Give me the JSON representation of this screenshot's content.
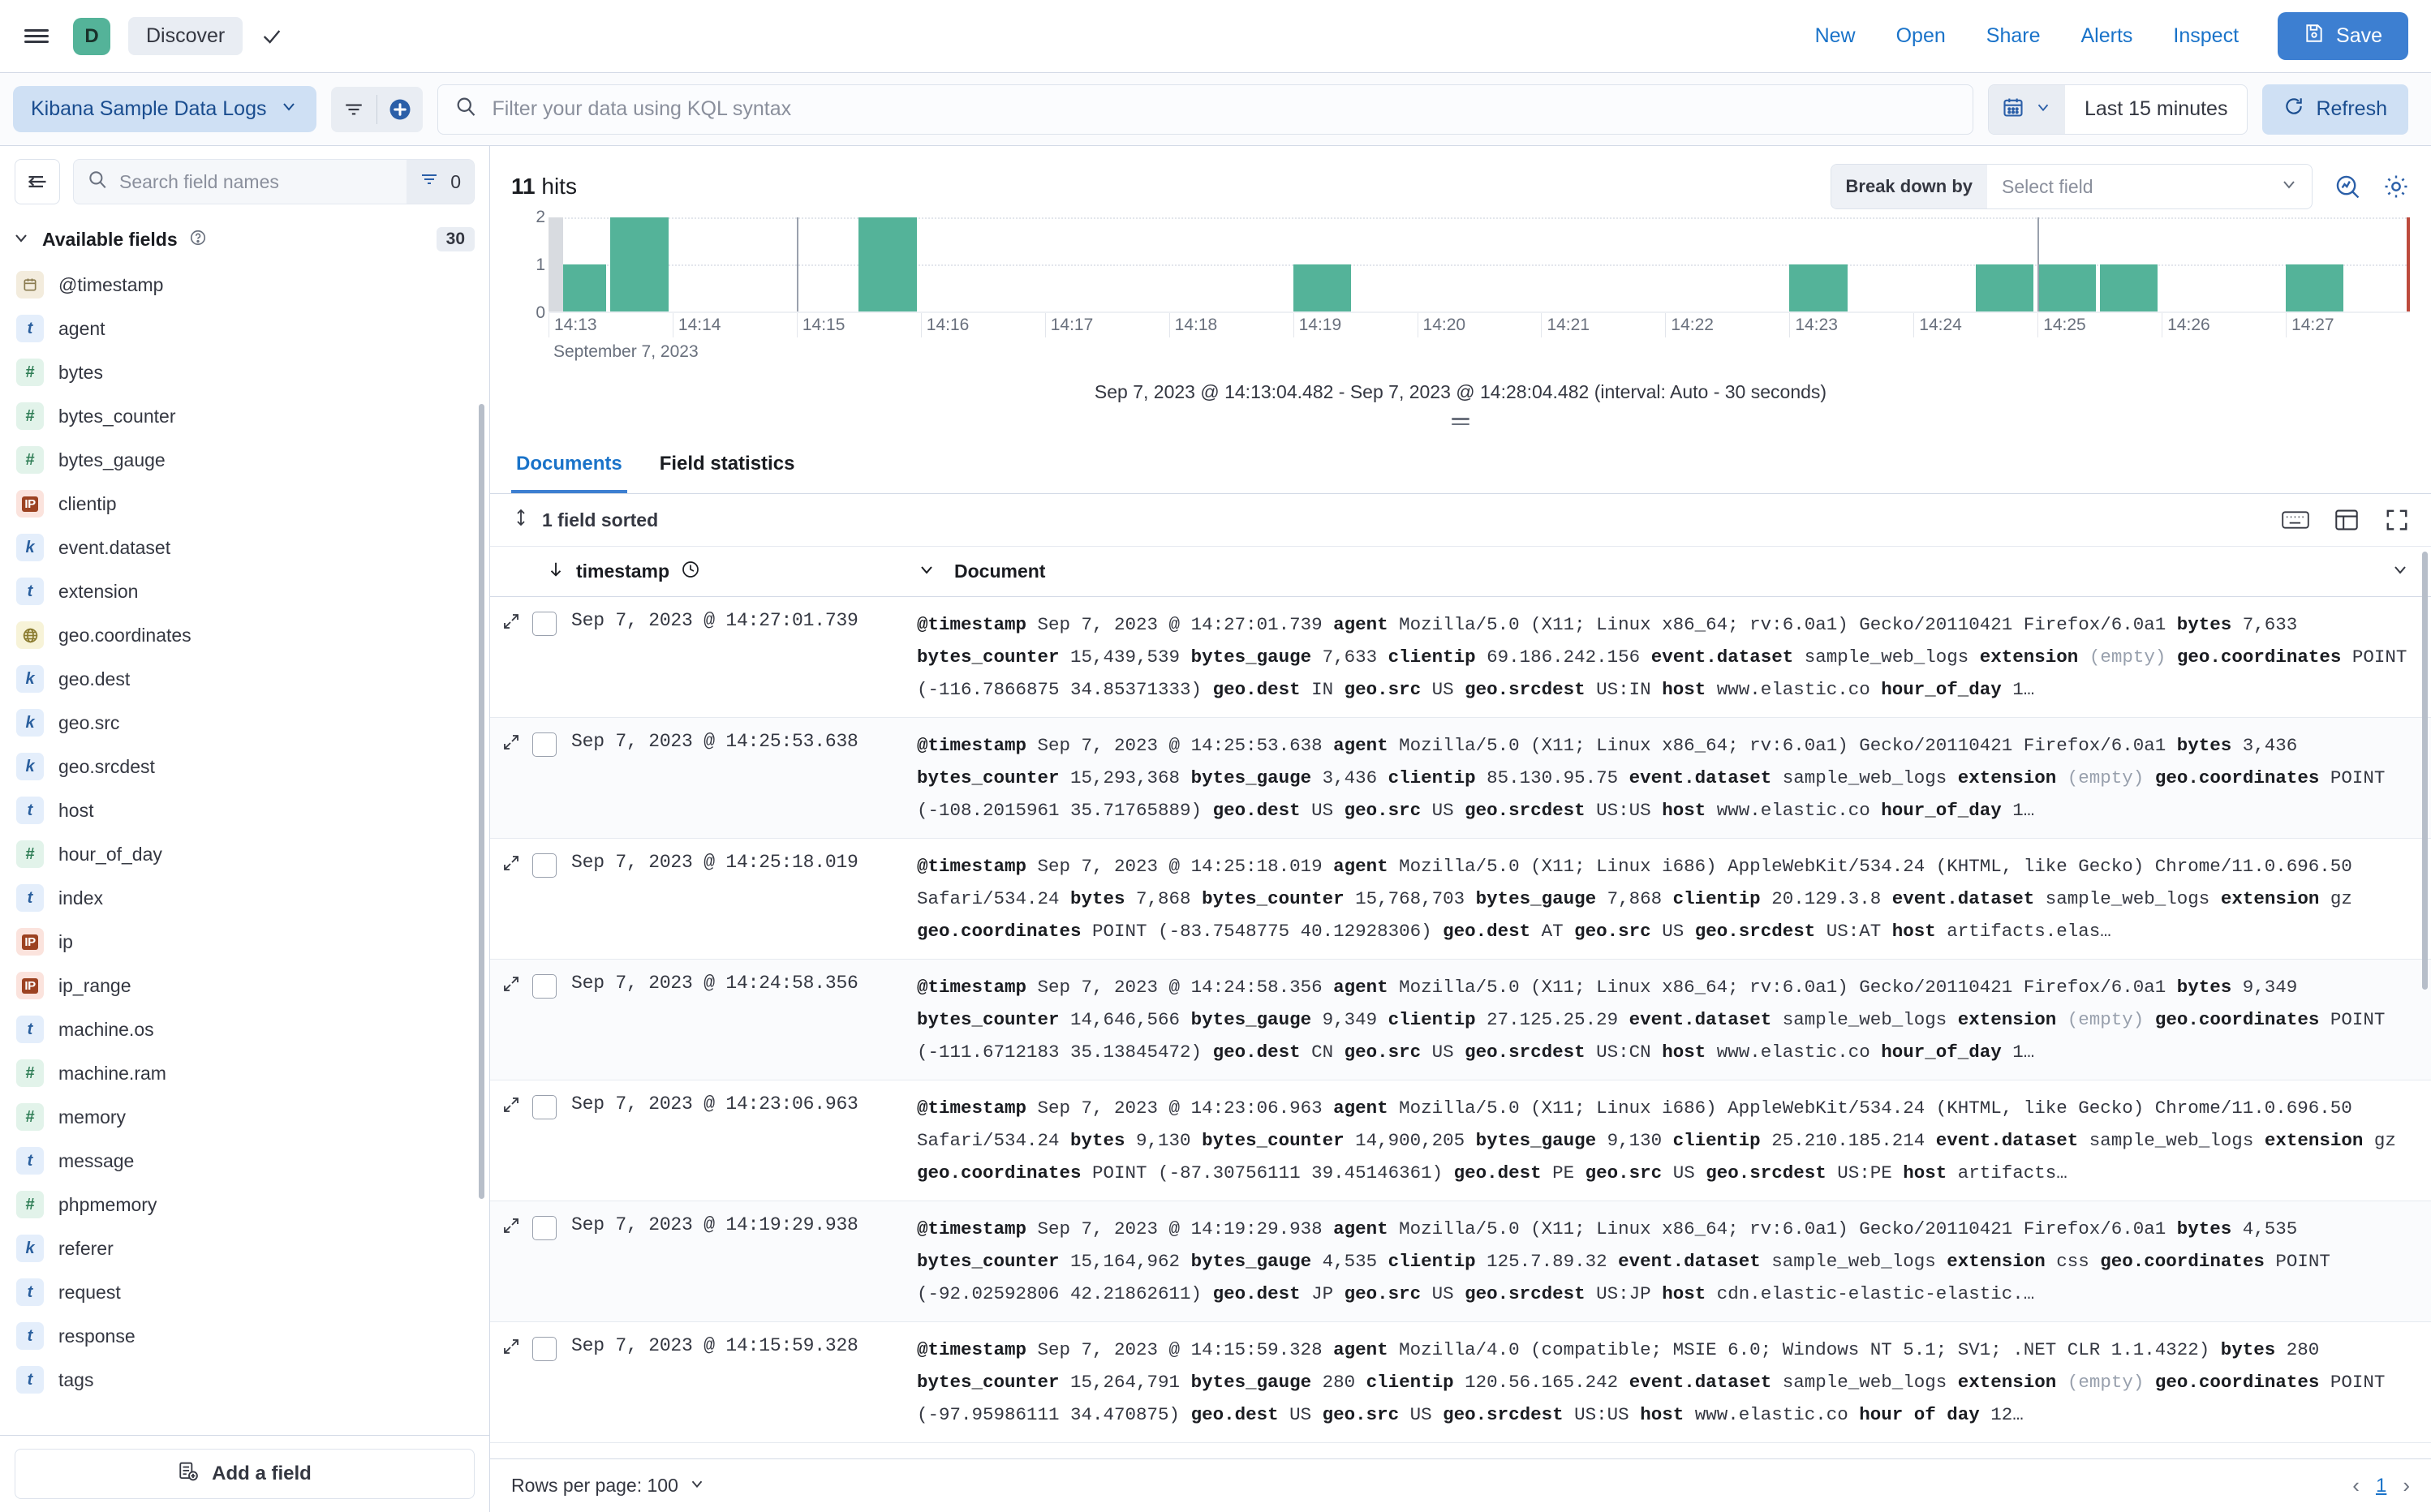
{
  "chrome": {
    "space_initial": "D",
    "breadcrumb": "Discover",
    "links": [
      "New",
      "Open",
      "Share",
      "Alerts",
      "Inspect"
    ],
    "save_label": "Save"
  },
  "querybar": {
    "data_view": "Kibana Sample Data Logs",
    "kql_placeholder": "Filter your data using KQL syntax",
    "time_range": "Last 15 minutes",
    "refresh_label": "Refresh"
  },
  "sidebar": {
    "search_placeholder": "Search field names",
    "filter_count": "0",
    "section_title": "Available fields",
    "field_count": "30",
    "add_field_label": "Add a field",
    "fields": [
      {
        "name": "@timestamp",
        "type": "date"
      },
      {
        "name": "agent",
        "type": "t"
      },
      {
        "name": "bytes",
        "type": "num"
      },
      {
        "name": "bytes_counter",
        "type": "num"
      },
      {
        "name": "bytes_gauge",
        "type": "num"
      },
      {
        "name": "clientip",
        "type": "ip"
      },
      {
        "name": "event.dataset",
        "type": "k"
      },
      {
        "name": "extension",
        "type": "t"
      },
      {
        "name": "geo.coordinates",
        "type": "geo"
      },
      {
        "name": "geo.dest",
        "type": "k"
      },
      {
        "name": "geo.src",
        "type": "k"
      },
      {
        "name": "geo.srcdest",
        "type": "k"
      },
      {
        "name": "host",
        "type": "t"
      },
      {
        "name": "hour_of_day",
        "type": "num"
      },
      {
        "name": "index",
        "type": "t"
      },
      {
        "name": "ip",
        "type": "ip"
      },
      {
        "name": "ip_range",
        "type": "ip"
      },
      {
        "name": "machine.os",
        "type": "t"
      },
      {
        "name": "machine.ram",
        "type": "num"
      },
      {
        "name": "memory",
        "type": "num"
      },
      {
        "name": "message",
        "type": "t"
      },
      {
        "name": "phpmemory",
        "type": "num"
      },
      {
        "name": "referer",
        "type": "k"
      },
      {
        "name": "request",
        "type": "t"
      },
      {
        "name": "response",
        "type": "t"
      },
      {
        "name": "tags",
        "type": "t"
      }
    ]
  },
  "main": {
    "hits_count": "11",
    "hits_label": "hits",
    "breakdown_label": "Break down by",
    "breakdown_value": "Select field",
    "chart_caption": "Sep 7, 2023 @ 14:13:04.482 - Sep 7, 2023 @ 14:28:04.482 (interval: Auto - 30 seconds)",
    "tabs": [
      {
        "label": "Documents",
        "active": true
      },
      {
        "label": "Field statistics",
        "active": false
      }
    ],
    "sorted_label": "1 field sorted",
    "columns": {
      "timestamp": "timestamp",
      "document": "Document"
    }
  },
  "chart_data": {
    "type": "bar",
    "title": "",
    "xlabel": "September 7, 2023",
    "ylabel": "",
    "ylim": [
      0,
      2
    ],
    "yticks": [
      "0",
      "1",
      "2"
    ],
    "grid": true,
    "interval": "Auto - 30 seconds",
    "xticks": [
      "14:13",
      "14:14",
      "14:15",
      "14:16",
      "14:17",
      "14:18",
      "14:19",
      "14:20",
      "14:21",
      "14:22",
      "14:23",
      "14:24",
      "14:25",
      "14:26",
      "14:27"
    ],
    "categories": [
      "14:13:00",
      "14:13:30",
      "14:14:00",
      "14:14:30",
      "14:15:00",
      "14:15:30",
      "14:16:00",
      "14:16:30",
      "14:17:00",
      "14:17:30",
      "14:18:00",
      "14:18:30",
      "14:19:00",
      "14:19:30",
      "14:20:00",
      "14:20:30",
      "14:21:00",
      "14:21:30",
      "14:22:00",
      "14:22:30",
      "14:23:00",
      "14:23:30",
      "14:24:00",
      "14:24:30",
      "14:25:00",
      "14:25:30",
      "14:26:00",
      "14:26:30",
      "14:27:00",
      "14:27:30"
    ],
    "values": [
      1,
      2,
      0,
      0,
      0,
      2,
      0,
      0,
      0,
      0,
      0,
      0,
      1,
      0,
      0,
      0,
      0,
      0,
      0,
      0,
      1,
      0,
      0,
      1,
      1,
      1,
      0,
      0,
      1,
      0
    ],
    "partial_first_bucket": true,
    "bar_color": "#54b399",
    "partial_color": "#d8dbe0"
  },
  "documents": [
    {
      "timestamp": "Sep 7, 2023 @ 14:27:01.739",
      "segments": [
        {
          "k": "@timestamp",
          "v": "Sep 7, 2023 @ 14:27:01.739"
        },
        {
          "k": "agent",
          "v": "Mozilla/5.0 (X11; Linux x86_64; rv:6.0a1) Gecko/20110421 Firefox/6.0a1"
        },
        {
          "k": "bytes",
          "v": "7,633"
        },
        {
          "k": "bytes_counter",
          "v": "15,439,539"
        },
        {
          "k": "bytes_gauge",
          "v": "7,633"
        },
        {
          "k": "clientip",
          "v": "69.186.242.156"
        },
        {
          "k": "event.dataset",
          "v": "sample_web_logs"
        },
        {
          "k": "extension",
          "v": "(empty)",
          "empty": true
        },
        {
          "k": "geo.coordinates",
          "v": "POINT (-116.7866875 34.85371333)"
        },
        {
          "k": "geo.dest",
          "v": "IN"
        },
        {
          "k": "geo.src",
          "v": "US"
        },
        {
          "k": "geo.srcdest",
          "v": "US:IN"
        },
        {
          "k": "host",
          "v": "www.elastic.co"
        },
        {
          "k": "hour_of_day",
          "v": "1…"
        }
      ]
    },
    {
      "timestamp": "Sep 7, 2023 @ 14:25:53.638",
      "segments": [
        {
          "k": "@timestamp",
          "v": "Sep 7, 2023 @ 14:25:53.638"
        },
        {
          "k": "agent",
          "v": "Mozilla/5.0 (X11; Linux x86_64; rv:6.0a1) Gecko/20110421 Firefox/6.0a1"
        },
        {
          "k": "bytes",
          "v": "3,436"
        },
        {
          "k": "bytes_counter",
          "v": "15,293,368"
        },
        {
          "k": "bytes_gauge",
          "v": "3,436"
        },
        {
          "k": "clientip",
          "v": "85.130.95.75"
        },
        {
          "k": "event.dataset",
          "v": "sample_web_logs"
        },
        {
          "k": "extension",
          "v": "(empty)",
          "empty": true
        },
        {
          "k": "geo.coordinates",
          "v": "POINT (-108.2015961 35.71765889)"
        },
        {
          "k": "geo.dest",
          "v": "US"
        },
        {
          "k": "geo.src",
          "v": "US"
        },
        {
          "k": "geo.srcdest",
          "v": "US:US"
        },
        {
          "k": "host",
          "v": "www.elastic.co"
        },
        {
          "k": "hour_of_day",
          "v": "1…"
        }
      ]
    },
    {
      "timestamp": "Sep 7, 2023 @ 14:25:18.019",
      "segments": [
        {
          "k": "@timestamp",
          "v": "Sep 7, 2023 @ 14:25:18.019"
        },
        {
          "k": "agent",
          "v": "Mozilla/5.0 (X11; Linux i686) AppleWebKit/534.24 (KHTML, like Gecko) Chrome/11.0.696.50 Safari/534.24"
        },
        {
          "k": "bytes",
          "v": "7,868"
        },
        {
          "k": "bytes_counter",
          "v": "15,768,703"
        },
        {
          "k": "bytes_gauge",
          "v": "7,868"
        },
        {
          "k": "clientip",
          "v": "20.129.3.8"
        },
        {
          "k": "event.dataset",
          "v": "sample_web_logs"
        },
        {
          "k": "extension",
          "v": "gz"
        },
        {
          "k": "geo.coordinates",
          "v": "POINT (-83.7548775 40.12928306)"
        },
        {
          "k": "geo.dest",
          "v": "AT"
        },
        {
          "k": "geo.src",
          "v": "US"
        },
        {
          "k": "geo.srcdest",
          "v": "US:AT"
        },
        {
          "k": "host",
          "v": "artifacts.elas…"
        }
      ]
    },
    {
      "timestamp": "Sep 7, 2023 @ 14:24:58.356",
      "segments": [
        {
          "k": "@timestamp",
          "v": "Sep 7, 2023 @ 14:24:58.356"
        },
        {
          "k": "agent",
          "v": "Mozilla/5.0 (X11; Linux x86_64; rv:6.0a1) Gecko/20110421 Firefox/6.0a1"
        },
        {
          "k": "bytes",
          "v": "9,349"
        },
        {
          "k": "bytes_counter",
          "v": "14,646,566"
        },
        {
          "k": "bytes_gauge",
          "v": "9,349"
        },
        {
          "k": "clientip",
          "v": "27.125.25.29"
        },
        {
          "k": "event.dataset",
          "v": "sample_web_logs"
        },
        {
          "k": "extension",
          "v": "(empty)",
          "empty": true
        },
        {
          "k": "geo.coordinates",
          "v": "POINT (-111.6712183 35.13845472)"
        },
        {
          "k": "geo.dest",
          "v": "CN"
        },
        {
          "k": "geo.src",
          "v": "US"
        },
        {
          "k": "geo.srcdest",
          "v": "US:CN"
        },
        {
          "k": "host",
          "v": "www.elastic.co"
        },
        {
          "k": "hour_of_day",
          "v": "1…"
        }
      ]
    },
    {
      "timestamp": "Sep 7, 2023 @ 14:23:06.963",
      "segments": [
        {
          "k": "@timestamp",
          "v": "Sep 7, 2023 @ 14:23:06.963"
        },
        {
          "k": "agent",
          "v": "Mozilla/5.0 (X11; Linux i686) AppleWebKit/534.24 (KHTML, like Gecko) Chrome/11.0.696.50 Safari/534.24"
        },
        {
          "k": "bytes",
          "v": "9,130"
        },
        {
          "k": "bytes_counter",
          "v": "14,900,205"
        },
        {
          "k": "bytes_gauge",
          "v": "9,130"
        },
        {
          "k": "clientip",
          "v": "25.210.185.214"
        },
        {
          "k": "event.dataset",
          "v": "sample_web_logs"
        },
        {
          "k": "extension",
          "v": "gz"
        },
        {
          "k": "geo.coordinates",
          "v": "POINT (-87.30756111 39.45146361)"
        },
        {
          "k": "geo.dest",
          "v": "PE"
        },
        {
          "k": "geo.src",
          "v": "US"
        },
        {
          "k": "geo.srcdest",
          "v": "US:PE"
        },
        {
          "k": "host",
          "v": "artifacts…"
        }
      ]
    },
    {
      "timestamp": "Sep 7, 2023 @ 14:19:29.938",
      "segments": [
        {
          "k": "@timestamp",
          "v": "Sep 7, 2023 @ 14:19:29.938"
        },
        {
          "k": "agent",
          "v": "Mozilla/5.0 (X11; Linux x86_64; rv:6.0a1) Gecko/20110421 Firefox/6.0a1"
        },
        {
          "k": "bytes",
          "v": "4,535"
        },
        {
          "k": "bytes_counter",
          "v": "15,164,962"
        },
        {
          "k": "bytes_gauge",
          "v": "4,535"
        },
        {
          "k": "clientip",
          "v": "125.7.89.32"
        },
        {
          "k": "event.dataset",
          "v": "sample_web_logs"
        },
        {
          "k": "extension",
          "v": "css"
        },
        {
          "k": "geo.coordinates",
          "v": "POINT (-92.02592806 42.21862611)"
        },
        {
          "k": "geo.dest",
          "v": "JP"
        },
        {
          "k": "geo.src",
          "v": "US"
        },
        {
          "k": "geo.srcdest",
          "v": "US:JP"
        },
        {
          "k": "host",
          "v": "cdn.elastic-elastic-elastic.…"
        }
      ]
    },
    {
      "timestamp": "Sep 7, 2023 @ 14:15:59.328",
      "segments": [
        {
          "k": "@timestamp",
          "v": "Sep 7, 2023 @ 14:15:59.328"
        },
        {
          "k": "agent",
          "v": "Mozilla/4.0 (compatible; MSIE 6.0; Windows NT 5.1; SV1; .NET CLR 1.1.4322)"
        },
        {
          "k": "bytes",
          "v": "280"
        },
        {
          "k": "bytes_counter",
          "v": "15,264,791"
        },
        {
          "k": "bytes_gauge",
          "v": "280"
        },
        {
          "k": "clientip",
          "v": "120.56.165.242"
        },
        {
          "k": "event.dataset",
          "v": "sample_web_logs"
        },
        {
          "k": "extension",
          "v": "(empty)",
          "empty": true
        },
        {
          "k": "geo.coordinates",
          "v": "POINT (-97.95986111 34.470875)"
        },
        {
          "k": "geo.dest",
          "v": "US"
        },
        {
          "k": "geo.src",
          "v": "US"
        },
        {
          "k": "geo.srcdest",
          "v": "US:US"
        },
        {
          "k": "host",
          "v": "www.elastic.co"
        },
        {
          "k": "hour of day",
          "v": "12…"
        }
      ]
    }
  ],
  "footer": {
    "rows_per_page_label": "Rows per page: 100",
    "current_page": "1"
  }
}
